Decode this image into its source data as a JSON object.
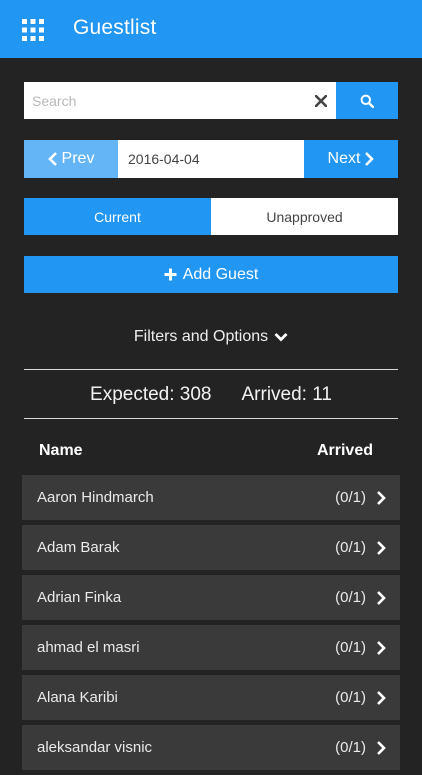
{
  "header": {
    "title": "Guestlist",
    "menu_icon": "apps-grid-icon"
  },
  "search": {
    "placeholder": "Search",
    "value": "",
    "clear_icon": "close-icon",
    "search_icon": "search-icon"
  },
  "date_nav": {
    "prev_label": "Prev",
    "next_label": "Next",
    "date": "2016-04-04"
  },
  "tabs": {
    "current": "Current",
    "unapproved": "Unapproved"
  },
  "add_guest_label": "Add Guest",
  "filters_label": "Filters and Options",
  "stats": {
    "expected": "Expected: 308",
    "arrived": "Arrived: 11"
  },
  "columns": {
    "name": "Name",
    "arrived": "Arrived"
  },
  "guests": [
    {
      "name": "Aaron Hindmarch",
      "status": "(0/1)"
    },
    {
      "name": "Adam Barak",
      "status": "(0/1)"
    },
    {
      "name": "Adrian Finka",
      "status": "(0/1)"
    },
    {
      "name": "ahmad el masri",
      "status": "(0/1)"
    },
    {
      "name": "Alana Karibi",
      "status": "(0/1)"
    },
    {
      "name": "aleksandar visnic",
      "status": "(0/1)"
    }
  ],
  "colors": {
    "accent": "#2196f3",
    "accent_light": "#64b5f6",
    "background": "#232323",
    "row": "#3a3a3a"
  }
}
